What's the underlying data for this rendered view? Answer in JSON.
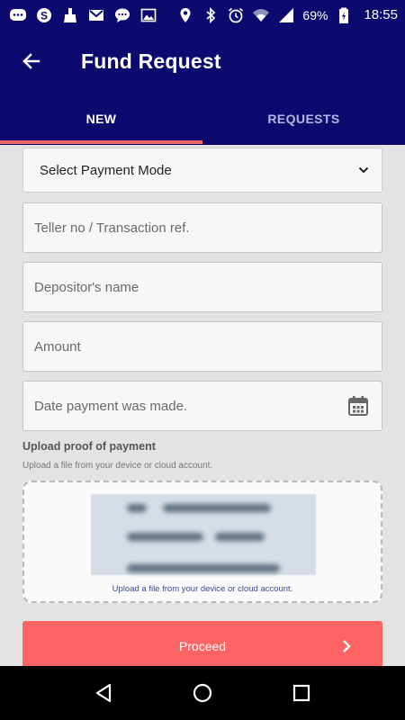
{
  "status_bar": {
    "battery": "69%",
    "time": "18:55",
    "icons": [
      "messenger-icon",
      "skype-icon",
      "cleaner-icon",
      "gmail-icon",
      "chat-icon",
      "image-icon",
      "location-icon",
      "bluetooth-icon",
      "alarm-icon",
      "wifi-icon",
      "signal-icon",
      "battery-icon"
    ]
  },
  "app_bar": {
    "title": "Fund Request",
    "back_icon": "arrow-back-icon"
  },
  "tabs": [
    {
      "label": "NEW",
      "active": true
    },
    {
      "label": "REQUESTS",
      "active": false
    }
  ],
  "colors": {
    "primary": "#0c0a6e",
    "accent": "#fe6464",
    "indicator": "#ee6a72"
  },
  "form": {
    "payment_mode": {
      "selected": "Select Payment Mode"
    },
    "teller_ref": {
      "placeholder": "Teller no / Transaction ref.",
      "value": ""
    },
    "depositor_name": {
      "placeholder": "Depositor's name",
      "value": ""
    },
    "amount": {
      "placeholder": "Amount",
      "value": ""
    },
    "payment_date": {
      "placeholder": "Date payment was made.",
      "value": ""
    }
  },
  "upload": {
    "title": "Upload proof of payment",
    "subtitle": "Upload a file from your device or cloud account.",
    "caption": "Upload a file from your device or cloud account."
  },
  "proceed": {
    "label": "Proceed"
  }
}
